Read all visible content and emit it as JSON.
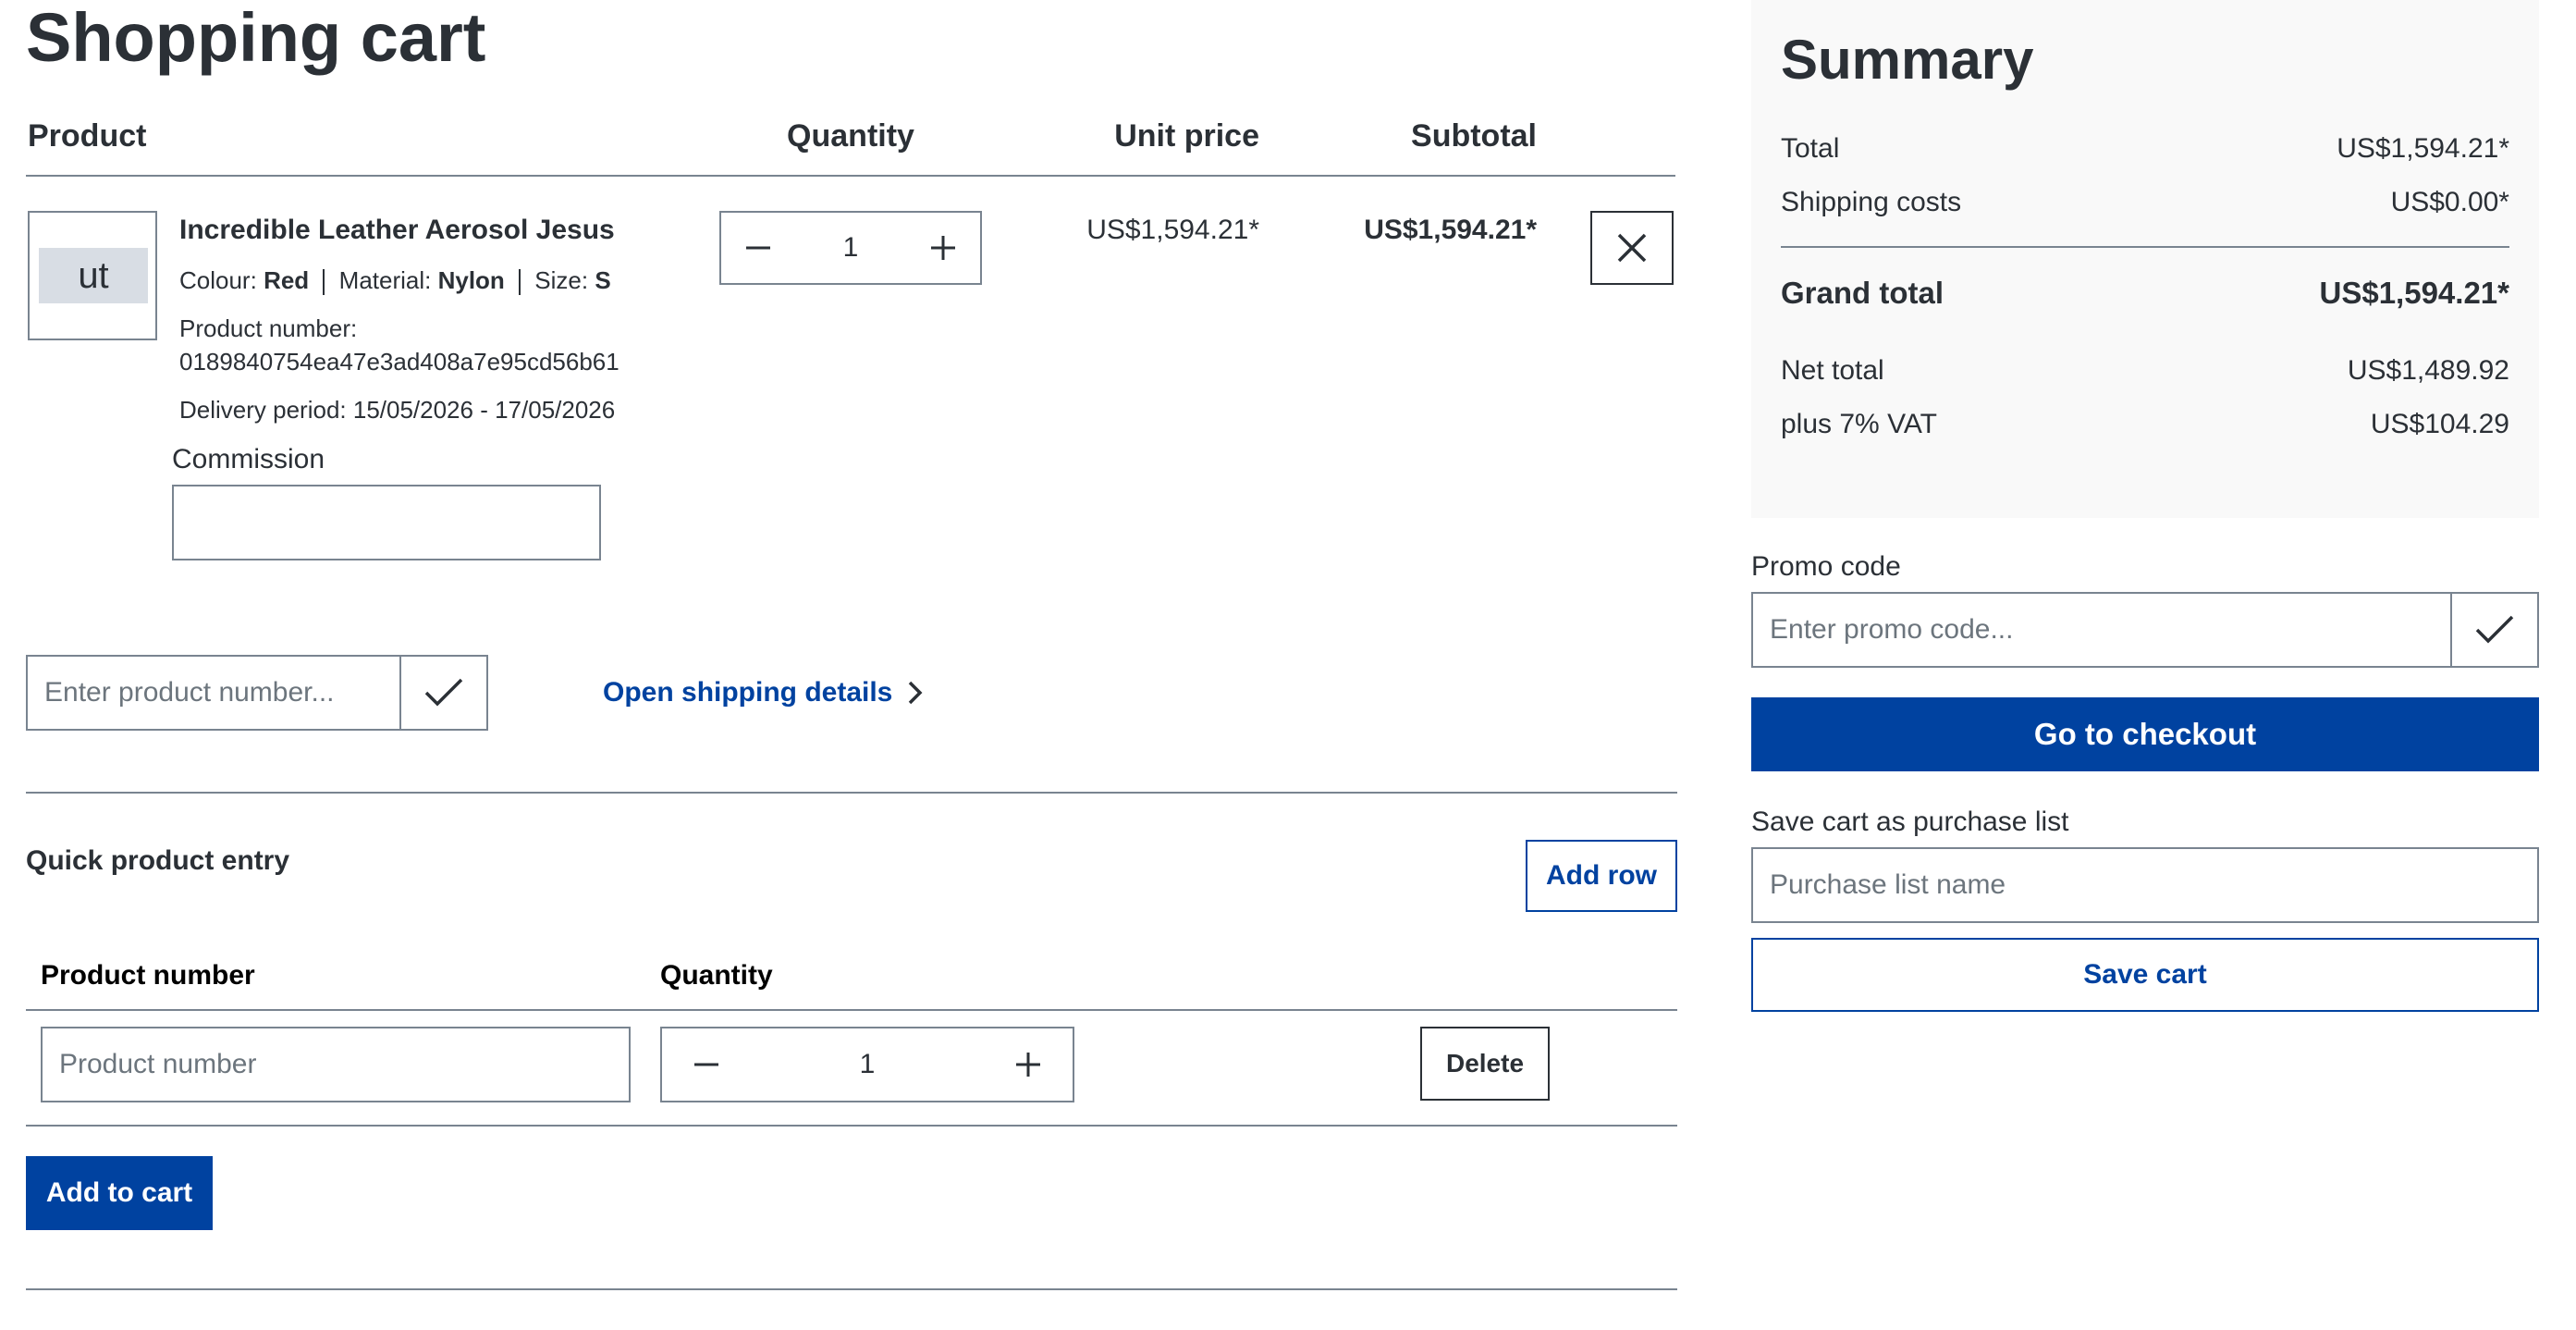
{
  "page": {
    "title": "Shopping cart"
  },
  "cart_table": {
    "headers": {
      "product": "Product",
      "quantity": "Quantity",
      "unit_price": "Unit price",
      "subtotal": "Subtotal"
    }
  },
  "line_item": {
    "thumbnail_text": "ut",
    "name": "Incredible Leather Aerosol Jesus",
    "colour_label": "Colour:",
    "colour_value": "Red",
    "material_label": "Material:",
    "material_value": "Nylon",
    "size_label": "Size:",
    "size_value": "S",
    "product_number_label": "Product number:",
    "product_number": "0189840754ea47e3ad408a7e95cd56b61",
    "delivery_period": "Delivery period: 15/05/2026 - 17/05/2026",
    "commission_label": "Commission",
    "commission_value": "",
    "quantity": "1",
    "unit_price": "US$1,594.21*",
    "subtotal": "US$1,594.21*"
  },
  "add_product": {
    "placeholder": "Enter product number...",
    "shipping_link": "Open shipping details"
  },
  "quick_entry": {
    "title": "Quick product entry",
    "add_row_label": "Add row",
    "col_product_number": "Product number",
    "col_quantity": "Quantity",
    "product_number_placeholder": "Product number",
    "quantity": "1",
    "delete_label": "Delete",
    "add_to_cart_label": "Add to cart"
  },
  "summary": {
    "title": "Summary",
    "total_label": "Total",
    "total_value": "US$1,594.21*",
    "shipping_label": "Shipping costs",
    "shipping_value": "US$0.00*",
    "grand_total_label": "Grand total",
    "grand_total_value": "US$1,594.21*",
    "net_total_label": "Net total",
    "net_total_value": "US$1,489.92",
    "vat_label": "plus 7% VAT",
    "vat_value": "US$104.29"
  },
  "promo": {
    "label": "Promo code",
    "placeholder": "Enter promo code..."
  },
  "checkout_label": "Go to checkout",
  "purchase_list": {
    "label": "Save cart as purchase list",
    "placeholder": "Purchase list name",
    "save_label": "Save cart"
  },
  "colors": {
    "primary": "#0042a0",
    "text": "#2b3036",
    "border": "#798490",
    "summary_bg": "#f9f9f9"
  }
}
